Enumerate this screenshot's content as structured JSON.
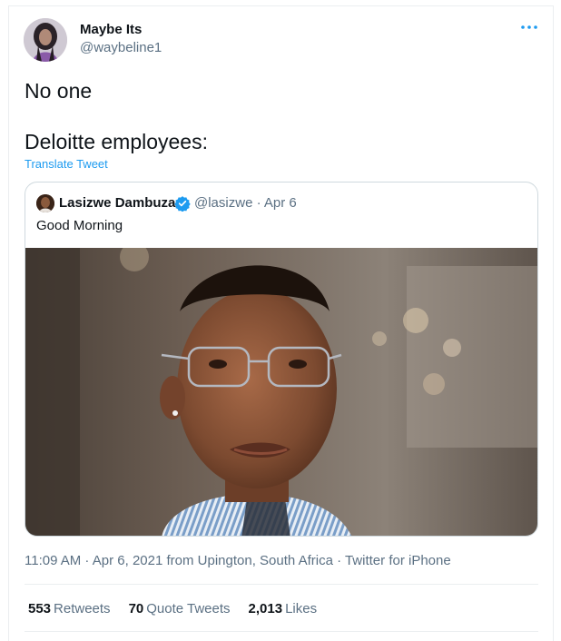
{
  "tweet": {
    "author_name": "Maybe Its",
    "author_handle": "@waybeline1",
    "more_icon": "more-horizontal-icon",
    "text_line1": "No one",
    "text_line2": "Deloitte employees:",
    "translate_label": "Translate Tweet",
    "timestamp": "11:09 AM · Apr 6, 2021 from Upington, South Africa · Twitter for iPhone"
  },
  "quoted": {
    "author_name": "Lasizwe Dambuza",
    "verified_icon": "verified-badge-icon",
    "handle_date": "@lasizwe · Apr 6",
    "text": "Good Morning"
  },
  "stats": {
    "retweets_count": "553",
    "retweets_label": "Retweets",
    "quotes_count": "70",
    "quotes_label": "Quote Tweets",
    "likes_count": "2,013",
    "likes_label": "Likes"
  },
  "colors": {
    "accent": "#1d9bf0",
    "secondary_text": "#5b7083",
    "border": "#cfd9de"
  }
}
